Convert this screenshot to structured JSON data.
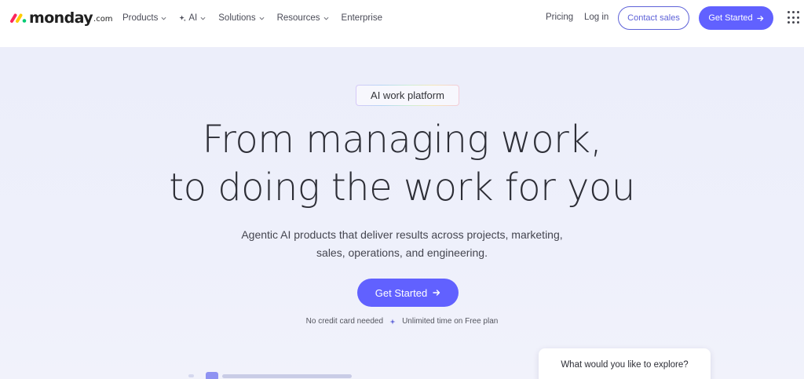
{
  "brand": {
    "name": "monday",
    "tld": ".com",
    "colors": {
      "red": "#fb275d",
      "yellow": "#ffcc00",
      "green": "#00ca72",
      "primary": "#6161ff"
    }
  },
  "nav": {
    "items": [
      {
        "label": "Products",
        "has_dropdown": true,
        "icon": ""
      },
      {
        "label": "AI",
        "has_dropdown": true,
        "icon": "sparkle-icon"
      },
      {
        "label": "Solutions",
        "has_dropdown": true,
        "icon": ""
      },
      {
        "label": "Resources",
        "has_dropdown": true,
        "icon": ""
      },
      {
        "label": "Enterprise",
        "has_dropdown": false,
        "icon": ""
      }
    ],
    "pricing": "Pricing",
    "login": "Log in",
    "contact_sales": "Contact sales",
    "get_started": "Get Started",
    "apps_icon": "apps-grid-icon"
  },
  "hero": {
    "badge": "AI work platform",
    "headline_line1": "From managing work,",
    "headline_line2": "to doing the work for you",
    "subtitle_line1": "Agentic AI products that deliver results across projects, marketing,",
    "subtitle_line2": "sales, operations, and engineering.",
    "cta": "Get Started",
    "note_left": "No credit card needed",
    "note_right": "Unlimited time on Free plan"
  },
  "explore": {
    "question": "What would you like to explore?"
  }
}
